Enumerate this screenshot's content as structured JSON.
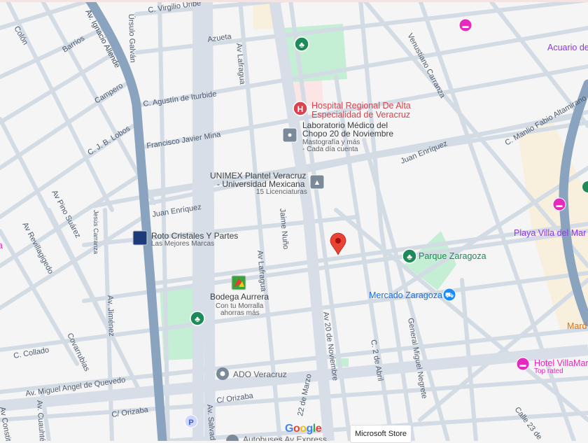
{
  "colors": {
    "park": "#c4efd4",
    "highway": "#8aa3bf",
    "road": "#d3dbe4",
    "marker": "#ea4335",
    "hospital": "#d9434e"
  },
  "streets": {
    "virgilio": "C. Virgilio Uribe",
    "colon": "Colón",
    "barrios": "Barrios",
    "allende": "Av. Ignacio Allende",
    "ursulo": "Úrsulo Galván",
    "azueta": "Azueta",
    "lafragua1": "Av Lafragua",
    "campero": "Campero",
    "iturbide": "C. Agustín de Iturbide",
    "lobos": "C. J. B. Lobos",
    "mina": "Francisco Javier Mina",
    "enriquez1": "Juan Enríquez",
    "enriquez2": "Juan Enríquez",
    "pino": "Av Pino Suárez",
    "revilla": "Av Revillagigedo",
    "jesus": "Jesús Carranza",
    "jaime": "Jaime Nuño",
    "lafragua2": "Av Lafragua",
    "jimenez": "Av. Jiménez",
    "collado": "C. Collado",
    "covarrubias": "Covarrubias",
    "quevedo": "Av. Miguel Angel de Quevedo",
    "orizaba1": "C/ Orizaba",
    "orizaba2": "C/ Orizaba",
    "salvador": "Av. Salvad",
    "cuauhtemoc": "Av. Cuauhté",
    "constitucion": "Av Constit",
    "venustiano": "Venustiano Carranza",
    "altamirano": "C. Manlio Fabio Altamirano",
    "noviembre": "Av 20 de Noviembre",
    "marzo": "22 de Marzo",
    "abril": "C. 2 de Abril",
    "negrete": "General Miguel Negrete",
    "calle23": "Calle 23 de"
  },
  "places": {
    "hospital": {
      "line1": "Hospital Regional De Alta",
      "line2": "Especialidad de Veracruz"
    },
    "laboratorio": {
      "line1": "Laboratorio Médico del",
      "line2": "Chopo 20 de Noviembre",
      "sub1": "Mastografía y más",
      "sub2": "- Cada día cuenta"
    },
    "unimex": {
      "line1": "UNIMEX Plantel Veracruz",
      "line2": "- Universidad Mexicana",
      "sub": "15 Licenciaturas"
    },
    "roto": {
      "name": "Roto Cristales Y Partes",
      "sub": "Las Mejores Marcas"
    },
    "bodega": {
      "name": "Bodega Aurrera",
      "sub1": "Con tu Morralla",
      "sub2": "ahorras más"
    },
    "ado": "ADO Veracruz",
    "autobuses": "Autobuses Av Express",
    "parque": "Parque Zaragoza",
    "mercado": "Mercado Zaragoza",
    "acuario": "Acuario de",
    "playa": "Playa Villa del Mar",
    "mardo": "Mard",
    "hotel": {
      "name": "Hotel VillaMar",
      "sub": "Top rated"
    },
    "left_pink": "a"
  },
  "footer": {
    "google": "Google",
    "ms_store": "Microsoft Store"
  },
  "icons": {
    "park": "tree-icon",
    "hospital": "hospital-icon",
    "hotel": "bed-icon",
    "school": "school-icon",
    "shop": "cart-icon",
    "bus": "bus-station-icon",
    "parking": "parking-icon",
    "pin": "location-pin-icon"
  }
}
